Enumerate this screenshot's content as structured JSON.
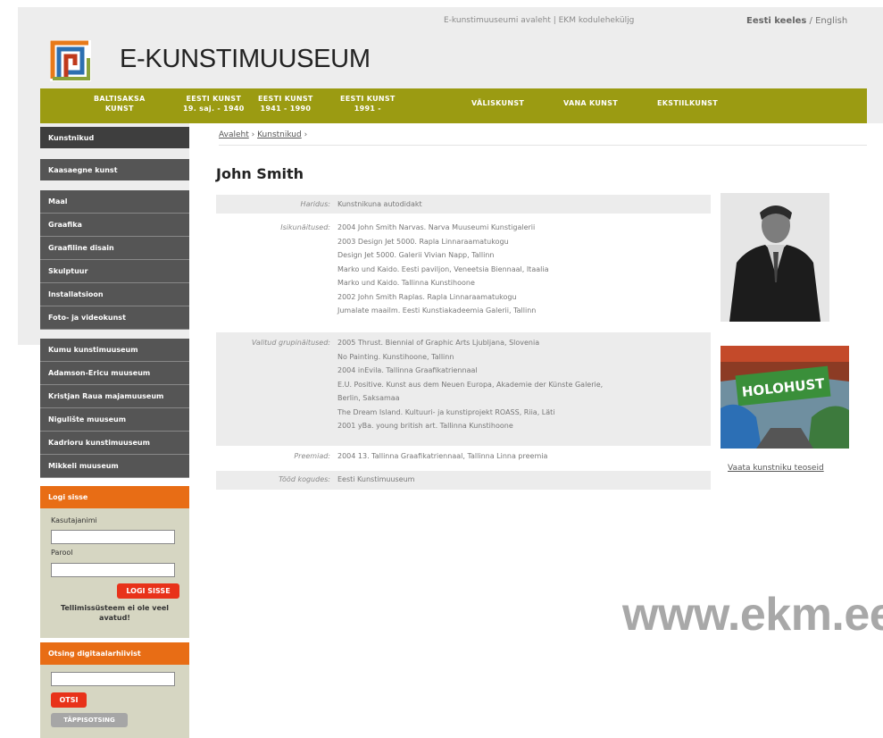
{
  "top": {
    "links": [
      "E-kunstimuuseumi avaleht",
      "EKM koduleheküljg"
    ],
    "separator": " | ",
    "lang_active": "Eesti keeles",
    "lang_sep": " / ",
    "lang_other": "English"
  },
  "site_title": "E-KUNSTIMUUSEUM",
  "nav": [
    {
      "line1": "BALTISAKSA",
      "line2": "KUNST"
    },
    {
      "line1": "EESTI KUNST",
      "line2": "19. saj. - 1940"
    },
    {
      "line1": "EESTI KUNST",
      "line2": "1941 - 1990"
    },
    {
      "line1": "EESTI KUNST",
      "line2": "1991 -"
    },
    {
      "line1": "VÄLISKUNST",
      "line2": ""
    },
    {
      "line1": "VANA KUNST",
      "line2": ""
    },
    {
      "line1": "EKSTIILKUNST",
      "line2": ""
    }
  ],
  "sidebar": {
    "active": "Kunstnikud",
    "contemporary": "Kaasaegne kunst",
    "categories": [
      "Maal",
      "Graafika",
      "Graafiline disain",
      "Skulptuur",
      "Installatsioon",
      "Foto- ja videokunst"
    ],
    "museums": [
      "Kumu kunstimuuseum",
      "Adamson-Ericu muuseum",
      "Kristjan Raua majamuuseum",
      "Nigulište muuseum",
      "Kadrioru kunstimuuseum",
      "Mikkeli muuseum"
    ]
  },
  "login": {
    "title": "Logi sisse",
    "username_label": "Kasutajanimi",
    "password_label": "Parool",
    "button": "LOGI SISSE",
    "note": "Tellimissüsteem ei ole veel avatud!"
  },
  "search": {
    "title": "Otsing digitaalarhiivist",
    "button": "OTSI",
    "advanced": "TÄPPISOTSING"
  },
  "breadcrumb": {
    "home": "Avaleht",
    "section": "Kunstnikud",
    "sep": " › "
  },
  "artist": {
    "name": "John Smith",
    "rows": [
      {
        "label": "Haridus:",
        "values": [
          "Kunstnikuna autodidakt"
        ]
      },
      {
        "label": "Isikunäitused:",
        "values": [
          "2004 John Smith Narvas. Narva Muuseumi Kunstigalerii",
          "2003 Design Jet 5000. Rapla Linnaraamatukogu",
          "Design Jet 5000. Galerii Vivian Napp, Tallinn",
          "Marko und Kaido. Eesti paviljon, Veneetsia Biennaal, Itaalia",
          "Marko und Kaido. Tallinna Kunstihoone",
          "2002 John Smith Raplas. Rapla Linnaraamatukogu",
          "Jumalate maailm. Eesti Kunstiakadeemia Galerii, Tallinn"
        ]
      },
      {
        "label": "Valitud grupinäitused:",
        "values": [
          "2005 Thrust. Biennial of Graphic Arts Ljubljana, Slovenia",
          "No Painting. Kunstihoone, Tallinn",
          "2004 inEvila. Tallinna Graafikatriennaal",
          "E.U. Positive. Kunst aus dem Neuen Europa, Akademie der Künste Galerie,",
          "Berlin, Saksamaa",
          "The Dream Island. Kultuuri- ja kunstiprojekt ROASS, Riia, Läti",
          "2001 yBa. young british art. Tallinna Kunstihoone"
        ]
      },
      {
        "label": "Preemiad:",
        "values": [
          "2004 13. Tallinna Graafikatriennaal, Tallinna Linna preemia"
        ]
      },
      {
        "label": "Tööd kogudes:",
        "values": [
          "Eesti Kunstimuuseum"
        ]
      }
    ]
  },
  "artwork_text": "HOLOHUST",
  "works_link": "Vaata kunstniku teoseid",
  "watermark": "www.ekm.ee",
  "colors": {
    "nav": "#9b9b12",
    "sidebar": "#555555",
    "accent": "#e86d15",
    "button": "#e8321a",
    "panel": "#d6d6c2"
  }
}
